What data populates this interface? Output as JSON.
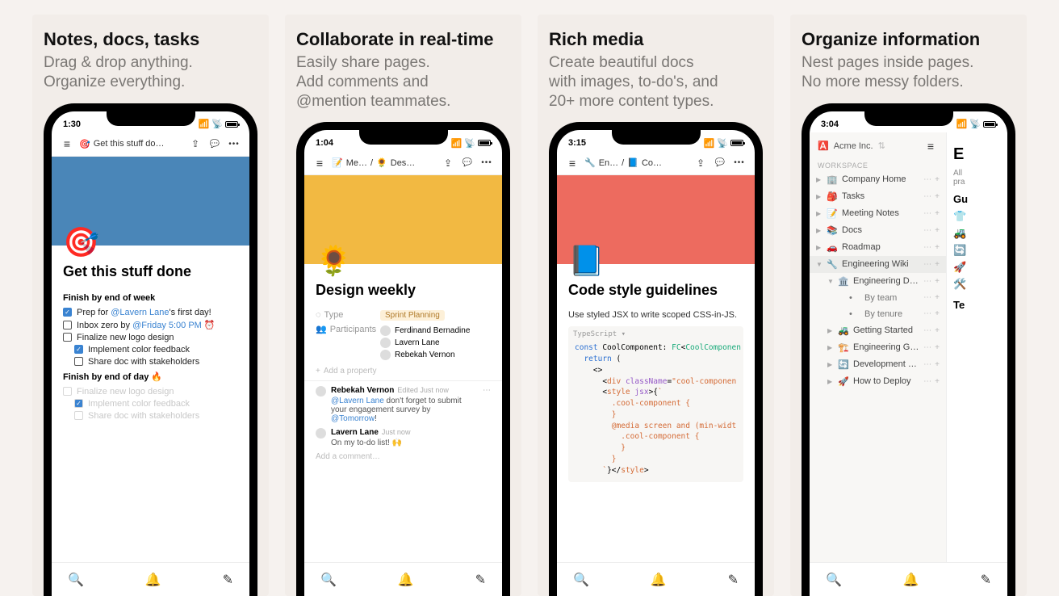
{
  "panels": [
    {
      "title": "Notes, docs, tasks",
      "subtitle": "Drag & drop anything.\nOrganize everything.",
      "time": "1:30",
      "breadcrumb_emoji": "🎯",
      "breadcrumb_text": "Get this stuff do…",
      "cover_class": "cover-blue",
      "page_emoji": "🎯",
      "page_title": "Get this stuff done",
      "section1": "Finish by end of week",
      "todos1": [
        {
          "checked": true,
          "indent": false,
          "text_pre": "Prep for ",
          "mention": "@Lavern Lane",
          "text_post": "'s first day!"
        },
        {
          "checked": false,
          "indent": false,
          "text_pre": "Inbox zero by ",
          "mention": "@Friday 5:00 PM ⏰",
          "text_post": ""
        },
        {
          "checked": false,
          "indent": false,
          "text_pre": "Finalize new logo design",
          "mention": "",
          "text_post": ""
        },
        {
          "checked": true,
          "indent": true,
          "text_pre": "Implement color feedback",
          "mention": "",
          "text_post": ""
        },
        {
          "checked": false,
          "indent": true,
          "text_pre": "Share doc with stakeholders",
          "mention": "",
          "text_post": ""
        }
      ],
      "section2": "Finish by end of day 🔥",
      "todos2": [
        {
          "checked": false,
          "indent": false,
          "text_pre": "Finalize new logo design"
        },
        {
          "checked": true,
          "indent": true,
          "text_pre": "Implement color feedback"
        },
        {
          "checked": false,
          "indent": true,
          "text_pre": "Share doc with stakeholders"
        }
      ]
    },
    {
      "title": "Collaborate in real-time",
      "subtitle": "Easily share pages.\nAdd comments and\n@mention teammates.",
      "time": "1:04",
      "crumb1_emoji": "📝",
      "crumb1_text": "Me…",
      "crumb2_emoji": "🌻",
      "crumb2_text": "Des…",
      "cover_class": "cover-yellow",
      "page_emoji": "🌻",
      "page_title": "Design weekly",
      "prop_type_label": "Type",
      "prop_type_value": "Sprint Planning",
      "prop_participants_label": "Participants",
      "participants": [
        "Ferdinand Bernadine",
        "Lavern Lane",
        "Rebekah Vernon"
      ],
      "add_property": "Add a property",
      "comments": [
        {
          "name": "Rebekah Vernon",
          "meta": "Edited Just now",
          "text_pre": "@Lavern Lane",
          "text_body": " don't forget to submit your engagement survey by ",
          "text_link": "@Tomorrow",
          "text_tail": "!"
        },
        {
          "name": "Lavern Lane",
          "meta": "Just now",
          "text_pre": "",
          "text_body": "On my to-do list! 🙌",
          "text_link": "",
          "text_tail": ""
        }
      ],
      "add_comment": "Add a comment…"
    },
    {
      "title": "Rich media",
      "subtitle": "Create beautiful docs\nwith images, to-do's, and\n20+ more content types.",
      "time": "3:15",
      "crumb1_emoji": "🔧",
      "crumb1_text": "En…",
      "crumb2_emoji": "📘",
      "crumb2_text": "Co…",
      "cover_class": "cover-red",
      "page_emoji": "📘",
      "page_title": "Code style guidelines",
      "body_text": "Use styled JSX to write scoped CSS-in-JS.",
      "code_lang": "TypeScript"
    },
    {
      "title": "Organize information",
      "subtitle": "Nest pages inside pages.\nNo more messy folders.",
      "time": "3:04",
      "workspace_name": "Acme Inc.",
      "workspace_label": "WORKSPACE",
      "nav": [
        {
          "caret": "▶",
          "emoji": "🏢",
          "name": "Company Home",
          "active": false,
          "level": 0
        },
        {
          "caret": "▶",
          "emoji": "🎒",
          "name": "Tasks",
          "active": false,
          "level": 0
        },
        {
          "caret": "▶",
          "emoji": "📝",
          "name": "Meeting Notes",
          "active": false,
          "level": 0
        },
        {
          "caret": "▶",
          "emoji": "📚",
          "name": "Docs",
          "active": false,
          "level": 0
        },
        {
          "caret": "▶",
          "emoji": "🚗",
          "name": "Roadmap",
          "active": false,
          "level": 0
        },
        {
          "caret": "▼",
          "emoji": "🔧",
          "name": "Engineering Wiki",
          "active": true,
          "level": 0
        },
        {
          "caret": "▼",
          "emoji": "🏛️",
          "name": "Engineering Directory",
          "active": false,
          "level": 1
        },
        {
          "caret": "",
          "emoji": "•",
          "name": "By team",
          "active": false,
          "level": 2
        },
        {
          "caret": "",
          "emoji": "•",
          "name": "By tenure",
          "active": false,
          "level": 2
        },
        {
          "caret": "▶",
          "emoji": "🚜",
          "name": "Getting Started",
          "active": false,
          "level": 1
        },
        {
          "caret": "▶",
          "emoji": "🏗️",
          "name": "Engineering Guidelin…",
          "active": false,
          "level": 1
        },
        {
          "caret": "▶",
          "emoji": "🔄",
          "name": "Development Lifecy…",
          "active": false,
          "level": 1
        },
        {
          "caret": "▶",
          "emoji": "🚀",
          "name": "How to Deploy",
          "active": false,
          "level": 1
        }
      ],
      "peek_title_letter": "E",
      "peek_sub1": "All",
      "peek_sub2": "pra",
      "peek_heading": "Gu",
      "peek_items": [
        {
          "emoji": "👕",
          "text": ""
        },
        {
          "emoji": "🚜",
          "text": ""
        },
        {
          "emoji": "🔄",
          "text": ""
        },
        {
          "emoji": "🚀",
          "text": ""
        },
        {
          "emoji": "🛠️",
          "text": ""
        }
      ],
      "peek_heading2": "Te"
    }
  ]
}
